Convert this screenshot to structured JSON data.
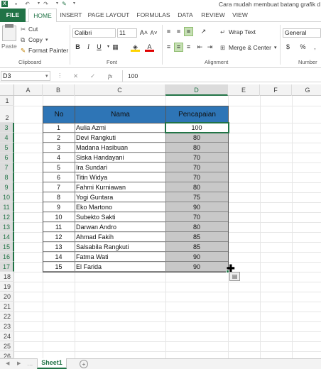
{
  "qat": {
    "icons": [
      "excel-app-icon",
      "save-icon",
      "undo-icon",
      "redo-icon",
      "paint-icon"
    ]
  },
  "window_title": "Cara mudah membuat batang grafik d",
  "tabs": [
    "FILE",
    "HOME",
    "INSERT",
    "PAGE LAYOUT",
    "FORMULAS",
    "DATA",
    "REVIEW",
    "VIEW"
  ],
  "clipboard": {
    "paste": "Paste",
    "cut": "Cut",
    "copy": "Copy",
    "copy_caret": "▾",
    "format_painter": "Format Painter",
    "group": "Clipboard"
  },
  "font": {
    "name": "Calibri",
    "size": "11",
    "bold": "B",
    "italic": "I",
    "underline": "U",
    "group": "Font"
  },
  "alignment": {
    "wrap": "Wrap Text",
    "merge": "Merge & Center",
    "group": "Alignment"
  },
  "number": {
    "format": "General",
    "group": "Number"
  },
  "formula_bar": {
    "name_box": "D3",
    "fx": "fx",
    "value": "100"
  },
  "columns": [
    "A",
    "B",
    "C",
    "D",
    "E",
    "F",
    "G"
  ],
  "rows": [
    "1",
    "2",
    "3",
    "4",
    "5",
    "6",
    "7",
    "8",
    "9",
    "10",
    "11",
    "12",
    "13",
    "14",
    "15",
    "16",
    "17",
    "18",
    "19",
    "20",
    "21",
    "22",
    "23",
    "24",
    "25",
    "26"
  ],
  "table": {
    "headers": [
      "No",
      "Nama",
      "Pencapaian"
    ],
    "rows": [
      {
        "no": "1",
        "nama": "Aulia Azmi",
        "nilai": "100"
      },
      {
        "no": "2",
        "nama": "Devi Rangkuti",
        "nilai": "80"
      },
      {
        "no": "3",
        "nama": "Madana Hasibuan",
        "nilai": "80"
      },
      {
        "no": "4",
        "nama": "Siska Handayani",
        "nilai": "70"
      },
      {
        "no": "5",
        "nama": "Ira Sundari",
        "nilai": "70"
      },
      {
        "no": "6",
        "nama": "Titin Widya",
        "nilai": "70"
      },
      {
        "no": "7",
        "nama": "Fahmi Kurniawan",
        "nilai": "80"
      },
      {
        "no": "8",
        "nama": "Yogi Guntara",
        "nilai": "75"
      },
      {
        "no": "9",
        "nama": "Eko Martono",
        "nilai": "90"
      },
      {
        "no": "10",
        "nama": "Subekto Sakti",
        "nilai": "70"
      },
      {
        "no": "11",
        "nama": "Darwan Andro",
        "nilai": "80"
      },
      {
        "no": "12",
        "nama": "Ahmad Fakih",
        "nilai": "85"
      },
      {
        "no": "13",
        "nama": "Salsabila Rangkuti",
        "nilai": "85"
      },
      {
        "no": "14",
        "nama": "Fatma Wati",
        "nilai": "90"
      },
      {
        "no": "15",
        "nama": "El Farida",
        "nilai": "90"
      }
    ]
  },
  "sheet_tab": "Sheet1",
  "colors": {
    "accent": "#217346",
    "header_fill": "#2e75b6",
    "selection": "#c8c8c8"
  }
}
